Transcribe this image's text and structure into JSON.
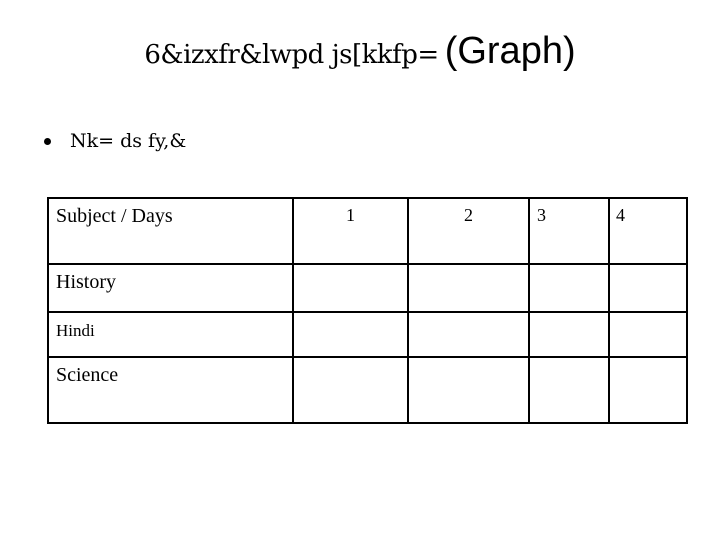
{
  "slide": {
    "title_main": "6&izxfr&lwpd js[kkfp=",
    "title_suffix": "(Graph)",
    "bullet": "Nk= ds fy,&"
  },
  "table": {
    "header": [
      "Subject / Days",
      "1",
      "2",
      "3",
      "4"
    ],
    "rows": [
      {
        "subject": "History",
        "values": [
          "",
          "",
          "",
          ""
        ]
      },
      {
        "subject": "Hindi",
        "values": [
          "",
          "",
          "",
          ""
        ]
      },
      {
        "subject": "Science",
        "values": [
          "",
          "",
          "",
          ""
        ]
      }
    ]
  }
}
